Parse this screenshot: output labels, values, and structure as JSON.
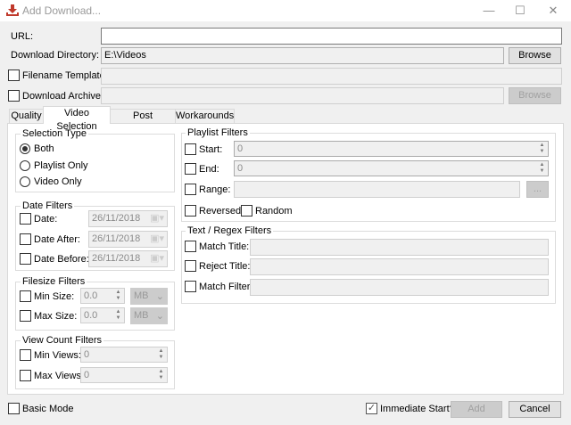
{
  "window": {
    "title": "Add Download...",
    "icon": "download-icon",
    "accent": "#c0392b"
  },
  "form": {
    "url_label": "URL:",
    "url_value": "",
    "dir_label": "Download Directory:",
    "dir_value": "E:\\Videos",
    "browse1": "Browse",
    "template_label": "Filename Template:",
    "template_value": "",
    "archive_label": "Download Archive:",
    "archive_value": "",
    "browse2": "Browse"
  },
  "tabs": [
    {
      "label": "Quality"
    },
    {
      "label": "Video Selection"
    },
    {
      "label": "Post Processing"
    },
    {
      "label": "Workarounds"
    }
  ],
  "selection": {
    "title": "Selection Type",
    "options": [
      "Both",
      "Playlist Only",
      "Video Only"
    ],
    "selected": "Both"
  },
  "date": {
    "title": "Date Filters",
    "rows": [
      {
        "label": "Date:",
        "value": "26/11/2018"
      },
      {
        "label": "Date After:",
        "value": "26/11/2018"
      },
      {
        "label": "Date Before:",
        "value": "26/11/2018"
      }
    ]
  },
  "filesize": {
    "title": "Filesize Filters",
    "rows": [
      {
        "label": "Min Size:",
        "value": "0.0",
        "unit": "MB"
      },
      {
        "label": "Max Size:",
        "value": "0.0",
        "unit": "MB"
      }
    ]
  },
  "views": {
    "title": "View Count Filters",
    "rows": [
      {
        "label": "Min Views:",
        "value": "0"
      },
      {
        "label": "Max Views:",
        "value": "0"
      }
    ]
  },
  "playlist": {
    "title": "Playlist Filters",
    "start_label": "Start:",
    "start_value": "0",
    "end_label": "End:",
    "end_value": "0",
    "range_label": "Range:",
    "range_value": "",
    "range_button": "...",
    "reversed": "Reversed",
    "random": "Random"
  },
  "regex": {
    "title": "Text / Regex Filters",
    "rows": [
      {
        "label": "Match Title:"
      },
      {
        "label": "Reject Title:"
      },
      {
        "label": "Match Filter:"
      }
    ]
  },
  "footer": {
    "basic_mode": "Basic Mode",
    "immediate": "Immediate Start?",
    "immediate_checked": true,
    "add": "Add",
    "cancel": "Cancel"
  }
}
